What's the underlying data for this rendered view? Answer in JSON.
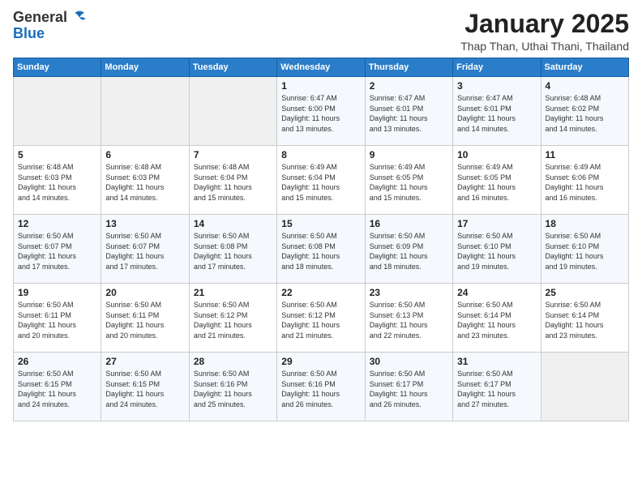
{
  "logo": {
    "general": "General",
    "blue": "Blue"
  },
  "header": {
    "title": "January 2025",
    "subtitle": "Thap Than, Uthai Thani, Thailand"
  },
  "weekdays": [
    "Sunday",
    "Monday",
    "Tuesday",
    "Wednesday",
    "Thursday",
    "Friday",
    "Saturday"
  ],
  "weeks": [
    [
      {
        "day": "",
        "info": ""
      },
      {
        "day": "",
        "info": ""
      },
      {
        "day": "",
        "info": ""
      },
      {
        "day": "1",
        "info": "Sunrise: 6:47 AM\nSunset: 6:00 PM\nDaylight: 11 hours\nand 13 minutes."
      },
      {
        "day": "2",
        "info": "Sunrise: 6:47 AM\nSunset: 6:01 PM\nDaylight: 11 hours\nand 13 minutes."
      },
      {
        "day": "3",
        "info": "Sunrise: 6:47 AM\nSunset: 6:01 PM\nDaylight: 11 hours\nand 14 minutes."
      },
      {
        "day": "4",
        "info": "Sunrise: 6:48 AM\nSunset: 6:02 PM\nDaylight: 11 hours\nand 14 minutes."
      }
    ],
    [
      {
        "day": "5",
        "info": "Sunrise: 6:48 AM\nSunset: 6:03 PM\nDaylight: 11 hours\nand 14 minutes."
      },
      {
        "day": "6",
        "info": "Sunrise: 6:48 AM\nSunset: 6:03 PM\nDaylight: 11 hours\nand 14 minutes."
      },
      {
        "day": "7",
        "info": "Sunrise: 6:48 AM\nSunset: 6:04 PM\nDaylight: 11 hours\nand 15 minutes."
      },
      {
        "day": "8",
        "info": "Sunrise: 6:49 AM\nSunset: 6:04 PM\nDaylight: 11 hours\nand 15 minutes."
      },
      {
        "day": "9",
        "info": "Sunrise: 6:49 AM\nSunset: 6:05 PM\nDaylight: 11 hours\nand 15 minutes."
      },
      {
        "day": "10",
        "info": "Sunrise: 6:49 AM\nSunset: 6:05 PM\nDaylight: 11 hours\nand 16 minutes."
      },
      {
        "day": "11",
        "info": "Sunrise: 6:49 AM\nSunset: 6:06 PM\nDaylight: 11 hours\nand 16 minutes."
      }
    ],
    [
      {
        "day": "12",
        "info": "Sunrise: 6:50 AM\nSunset: 6:07 PM\nDaylight: 11 hours\nand 17 minutes."
      },
      {
        "day": "13",
        "info": "Sunrise: 6:50 AM\nSunset: 6:07 PM\nDaylight: 11 hours\nand 17 minutes."
      },
      {
        "day": "14",
        "info": "Sunrise: 6:50 AM\nSunset: 6:08 PM\nDaylight: 11 hours\nand 17 minutes."
      },
      {
        "day": "15",
        "info": "Sunrise: 6:50 AM\nSunset: 6:08 PM\nDaylight: 11 hours\nand 18 minutes."
      },
      {
        "day": "16",
        "info": "Sunrise: 6:50 AM\nSunset: 6:09 PM\nDaylight: 11 hours\nand 18 minutes."
      },
      {
        "day": "17",
        "info": "Sunrise: 6:50 AM\nSunset: 6:10 PM\nDaylight: 11 hours\nand 19 minutes."
      },
      {
        "day": "18",
        "info": "Sunrise: 6:50 AM\nSunset: 6:10 PM\nDaylight: 11 hours\nand 19 minutes."
      }
    ],
    [
      {
        "day": "19",
        "info": "Sunrise: 6:50 AM\nSunset: 6:11 PM\nDaylight: 11 hours\nand 20 minutes."
      },
      {
        "day": "20",
        "info": "Sunrise: 6:50 AM\nSunset: 6:11 PM\nDaylight: 11 hours\nand 20 minutes."
      },
      {
        "day": "21",
        "info": "Sunrise: 6:50 AM\nSunset: 6:12 PM\nDaylight: 11 hours\nand 21 minutes."
      },
      {
        "day": "22",
        "info": "Sunrise: 6:50 AM\nSunset: 6:12 PM\nDaylight: 11 hours\nand 21 minutes."
      },
      {
        "day": "23",
        "info": "Sunrise: 6:50 AM\nSunset: 6:13 PM\nDaylight: 11 hours\nand 22 minutes."
      },
      {
        "day": "24",
        "info": "Sunrise: 6:50 AM\nSunset: 6:14 PM\nDaylight: 11 hours\nand 23 minutes."
      },
      {
        "day": "25",
        "info": "Sunrise: 6:50 AM\nSunset: 6:14 PM\nDaylight: 11 hours\nand 23 minutes."
      }
    ],
    [
      {
        "day": "26",
        "info": "Sunrise: 6:50 AM\nSunset: 6:15 PM\nDaylight: 11 hours\nand 24 minutes."
      },
      {
        "day": "27",
        "info": "Sunrise: 6:50 AM\nSunset: 6:15 PM\nDaylight: 11 hours\nand 24 minutes."
      },
      {
        "day": "28",
        "info": "Sunrise: 6:50 AM\nSunset: 6:16 PM\nDaylight: 11 hours\nand 25 minutes."
      },
      {
        "day": "29",
        "info": "Sunrise: 6:50 AM\nSunset: 6:16 PM\nDaylight: 11 hours\nand 26 minutes."
      },
      {
        "day": "30",
        "info": "Sunrise: 6:50 AM\nSunset: 6:17 PM\nDaylight: 11 hours\nand 26 minutes."
      },
      {
        "day": "31",
        "info": "Sunrise: 6:50 AM\nSunset: 6:17 PM\nDaylight: 11 hours\nand 27 minutes."
      },
      {
        "day": "",
        "info": ""
      }
    ]
  ]
}
